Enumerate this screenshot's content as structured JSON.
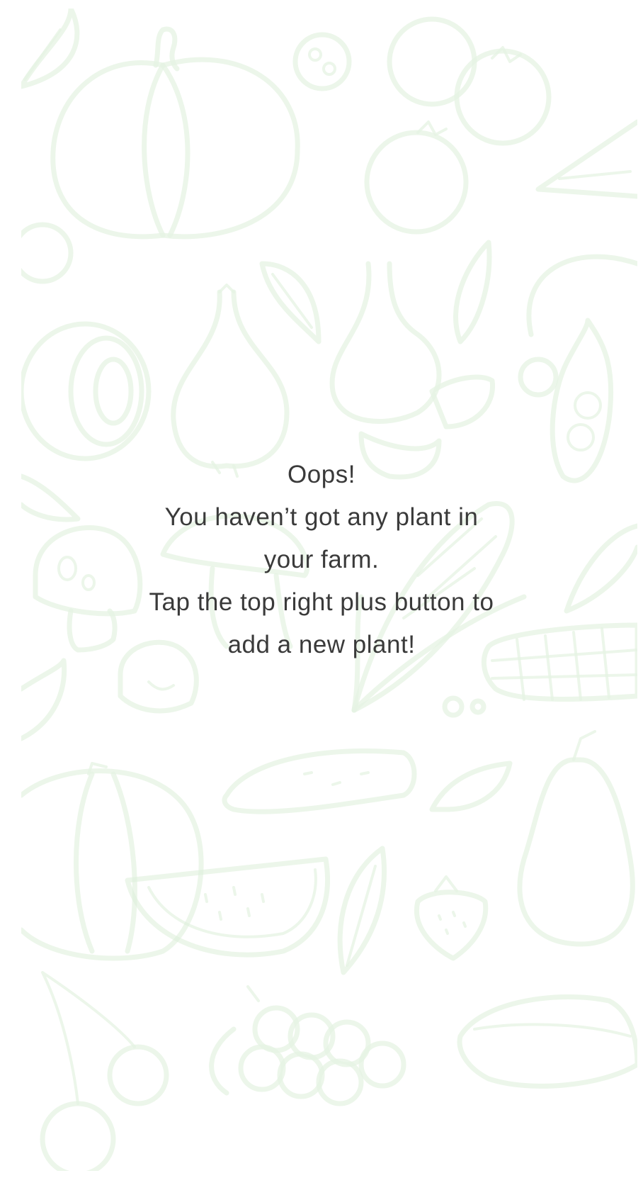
{
  "empty_state": {
    "line1": "Oops!",
    "line2": "You haven’t got any plant in",
    "line3": "your farm.",
    "line4": "Tap the top right plus button to",
    "line5": "add a new plant!"
  },
  "background": {
    "illustration": "vegetable-doodle-pattern",
    "line_color": "#dcefd9"
  },
  "colors": {
    "text": "#3a3a3a",
    "background": "#ffffff"
  }
}
